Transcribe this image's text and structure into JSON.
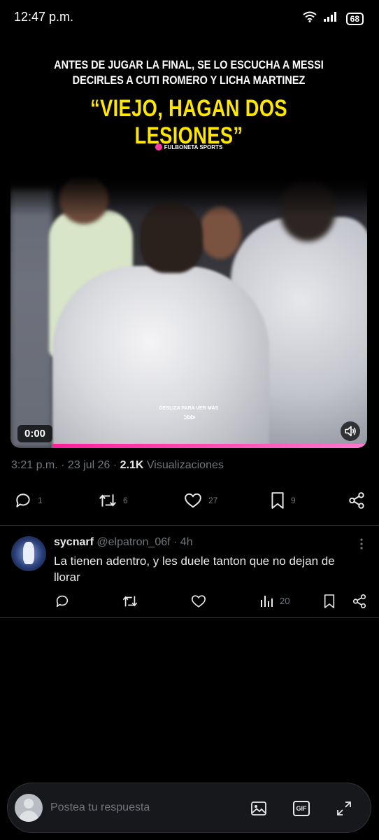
{
  "status_bar": {
    "time": "12:47 p.m.",
    "battery": "68",
    "icons": [
      "wifi-icon",
      "signal-icon",
      "battery-icon"
    ]
  },
  "media": {
    "headline_line1": "ANTES DE JUGAR LA FINAL, SE LO ESCUCHA A MESSI",
    "headline_line2": "DECIRLES A CUTI ROMERO Y LICHA MARTINEZ",
    "quote": "“VIEJO, HAGAN DOS LESIONES”",
    "brand": "FULBONETA SPORTS",
    "swipe_text": "DESLIZA PARA VER MÁS",
    "swipe_arrows": ">>>",
    "duration": "0:00",
    "quote_color": "#ffe600",
    "accent_color": "#ff1f9b"
  },
  "post_meta": {
    "time": "3:21 p.m.",
    "sep1": " · ",
    "date": "23 jul 26",
    "sep2": " · ",
    "views": "2.1K",
    "views_label": " Visualizaciones"
  },
  "actions": {
    "replies": "1",
    "reposts": "6",
    "likes": "27",
    "bookmarks": "9"
  },
  "reply": {
    "name": "sycnarf",
    "handle": " @elpatron_06f",
    "time": " · 4h",
    "text": "La tienen adentro, y les duele tanton que no dejan de llorar",
    "views": "20"
  },
  "compose": {
    "placeholder": "Postea tu respuesta",
    "gif_label": "GIF"
  },
  "colors": {
    "background": "#000000",
    "text": "#e7e9ea",
    "muted": "#71767b",
    "divider": "#2f3336"
  }
}
